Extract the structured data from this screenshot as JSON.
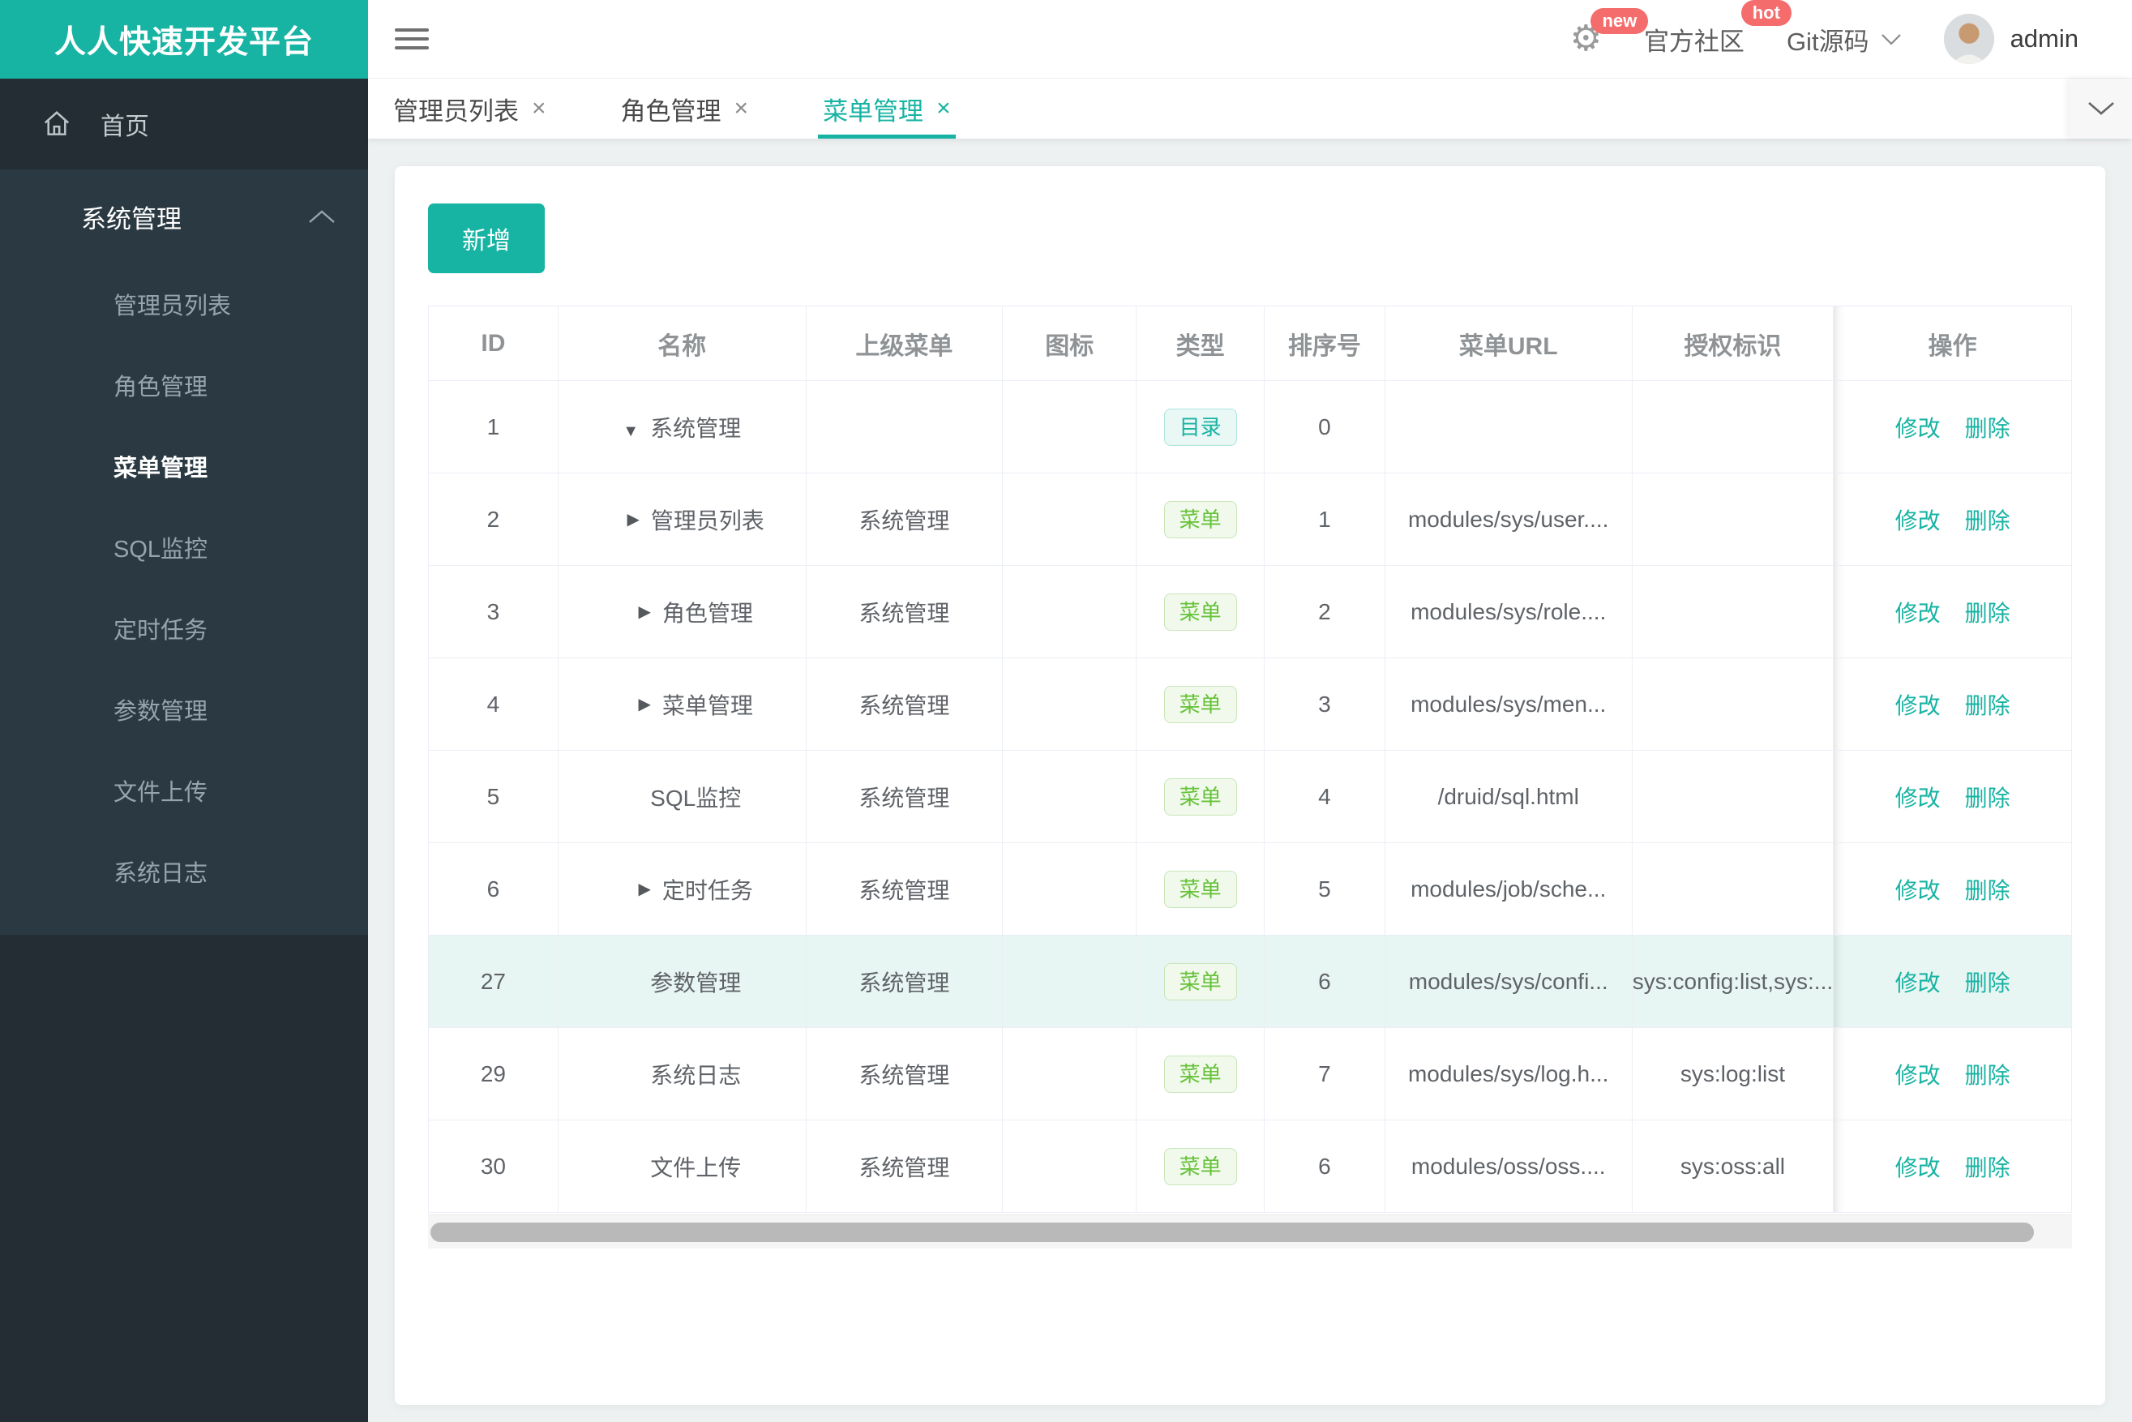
{
  "app": {
    "title": "人人快速开发平台"
  },
  "topbar": {
    "settings_badge": "new",
    "community_label": "官方社区",
    "community_badge": "hot",
    "git_label": "Git源码",
    "username": "admin"
  },
  "tabs": [
    {
      "label": "管理员列表",
      "active": false
    },
    {
      "label": "角色管理",
      "active": false
    },
    {
      "label": "菜单管理",
      "active": true
    }
  ],
  "tab_close_glyph": "×",
  "sidebar": {
    "home_label": "首页",
    "group_label": "系统管理",
    "items": [
      "管理员列表",
      "角色管理",
      "菜单管理",
      "SQL监控",
      "定时任务",
      "参数管理",
      "文件上传",
      "系统日志"
    ],
    "active_item": "菜单管理"
  },
  "toolbar": {
    "add_label": "新增"
  },
  "table": {
    "columns": [
      "ID",
      "名称",
      "上级菜单",
      "图标",
      "类型",
      "排序号",
      "菜单URL",
      "授权标识",
      "操作"
    ],
    "actions": {
      "edit": "修改",
      "delete": "删除"
    },
    "rows": [
      {
        "id": "1",
        "arrow": "down",
        "level": 0,
        "name": "系统管理",
        "parent": "",
        "icon": "",
        "type": "目录",
        "type_kind": "dir",
        "order": "0",
        "url": "",
        "perms": "",
        "highlight": false
      },
      {
        "id": "2",
        "arrow": "right",
        "level": 1,
        "name": "管理员列表",
        "parent": "系统管理",
        "icon": "",
        "type": "菜单",
        "type_kind": "menu",
        "order": "1",
        "url": "modules/sys/user....",
        "perms": "",
        "highlight": false
      },
      {
        "id": "3",
        "arrow": "right",
        "level": 1,
        "name": "角色管理",
        "parent": "系统管理",
        "icon": "",
        "type": "菜单",
        "type_kind": "menu",
        "order": "2",
        "url": "modules/sys/role....",
        "perms": "",
        "highlight": false
      },
      {
        "id": "4",
        "arrow": "right",
        "level": 1,
        "name": "菜单管理",
        "parent": "系统管理",
        "icon": "",
        "type": "菜单",
        "type_kind": "menu",
        "order": "3",
        "url": "modules/sys/men...",
        "perms": "",
        "highlight": false
      },
      {
        "id": "5",
        "arrow": "",
        "level": 1,
        "name": "SQL监控",
        "parent": "系统管理",
        "icon": "",
        "type": "菜单",
        "type_kind": "menu",
        "order": "4",
        "url": "/druid/sql.html",
        "perms": "",
        "highlight": false
      },
      {
        "id": "6",
        "arrow": "right",
        "level": 1,
        "name": "定时任务",
        "parent": "系统管理",
        "icon": "",
        "type": "菜单",
        "type_kind": "menu",
        "order": "5",
        "url": "modules/job/sche...",
        "perms": "",
        "highlight": false
      },
      {
        "id": "27",
        "arrow": "",
        "level": 1,
        "name": "参数管理",
        "parent": "系统管理",
        "icon": "",
        "type": "菜单",
        "type_kind": "menu",
        "order": "6",
        "url": "modules/sys/confi...",
        "perms": "sys:config:list,sys:...",
        "highlight": true
      },
      {
        "id": "29",
        "arrow": "",
        "level": 1,
        "name": "系统日志",
        "parent": "系统管理",
        "icon": "",
        "type": "菜单",
        "type_kind": "menu",
        "order": "7",
        "url": "modules/sys/log.h...",
        "perms": "sys:log:list",
        "highlight": false
      },
      {
        "id": "30",
        "arrow": "",
        "level": 1,
        "name": "文件上传",
        "parent": "系统管理",
        "icon": "",
        "type": "菜单",
        "type_kind": "menu",
        "order": "6",
        "url": "modules/oss/oss....",
        "perms": "sys:oss:all",
        "highlight": false
      }
    ]
  },
  "colors": {
    "primary": "#17b3a3",
    "badge_red": "#f56c6c",
    "tag_menu_green": "#67c23a",
    "sidebar_dark": "#232d33",
    "sidebar_block": "#2b3a42",
    "row_highlight": "#e8f6f3"
  },
  "glyphs": {
    "arrow_down": "▼",
    "arrow_right": "▶"
  }
}
